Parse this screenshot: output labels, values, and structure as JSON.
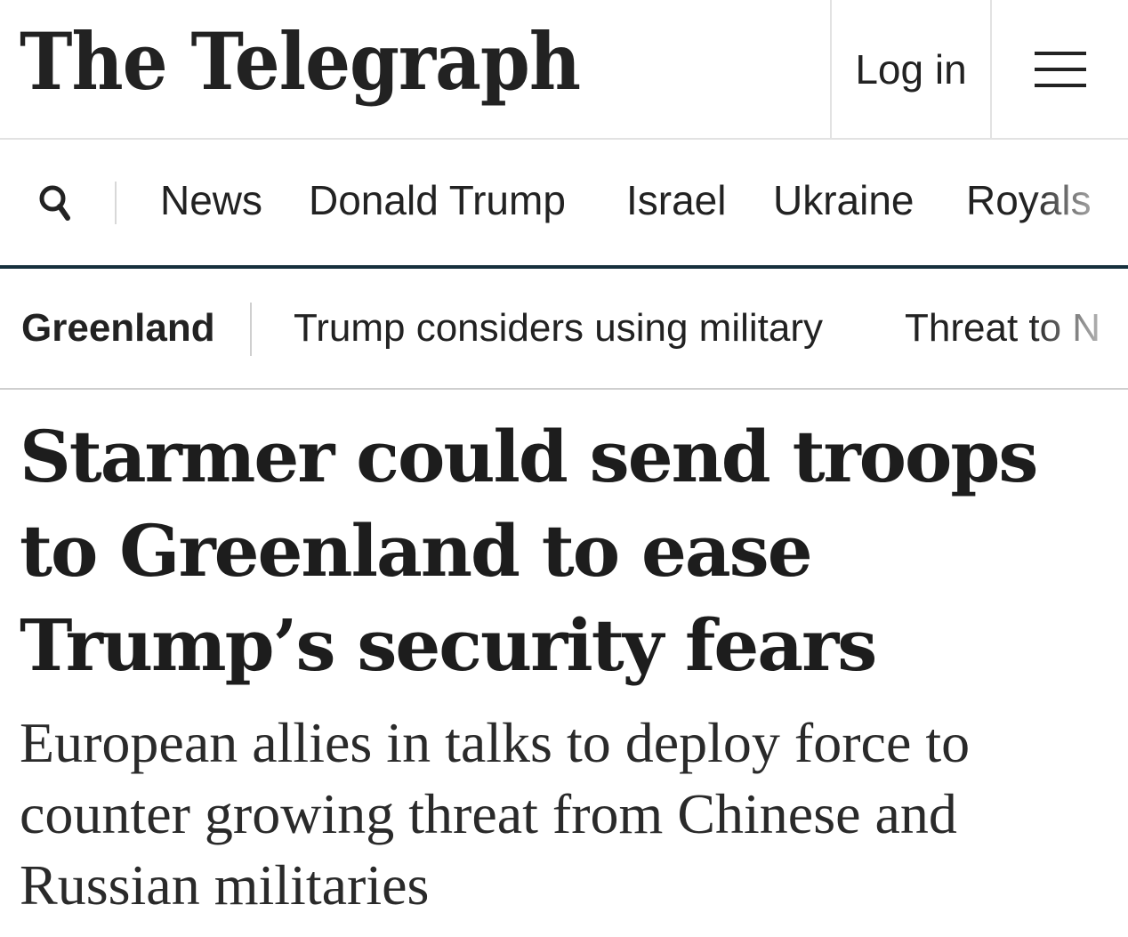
{
  "masthead": {
    "logo_text": "The Telegraph",
    "login_label": "Log in",
    "menu_icon": "hamburger-icon"
  },
  "primary_nav": {
    "search_icon": "search-icon",
    "items": [
      {
        "label": "News"
      },
      {
        "label": "Donald Trump"
      },
      {
        "label": "Israel"
      },
      {
        "label": "Ukraine"
      },
      {
        "label": "Royals"
      }
    ]
  },
  "topic_bar": {
    "label": "Greenland",
    "links": [
      {
        "label": "Trump considers using military"
      },
      {
        "label": "Threat to N"
      }
    ]
  },
  "article": {
    "headline": "Starmer could send troops to Greenland to ease Trump’s security fears",
    "standfirst": "European allies in talks to deploy force to counter growing threat from Chinese and Russian militaries"
  },
  "colors": {
    "nav_underline": "#16303d",
    "text": "#1d1d1d",
    "divider": "#e2e2e2"
  }
}
